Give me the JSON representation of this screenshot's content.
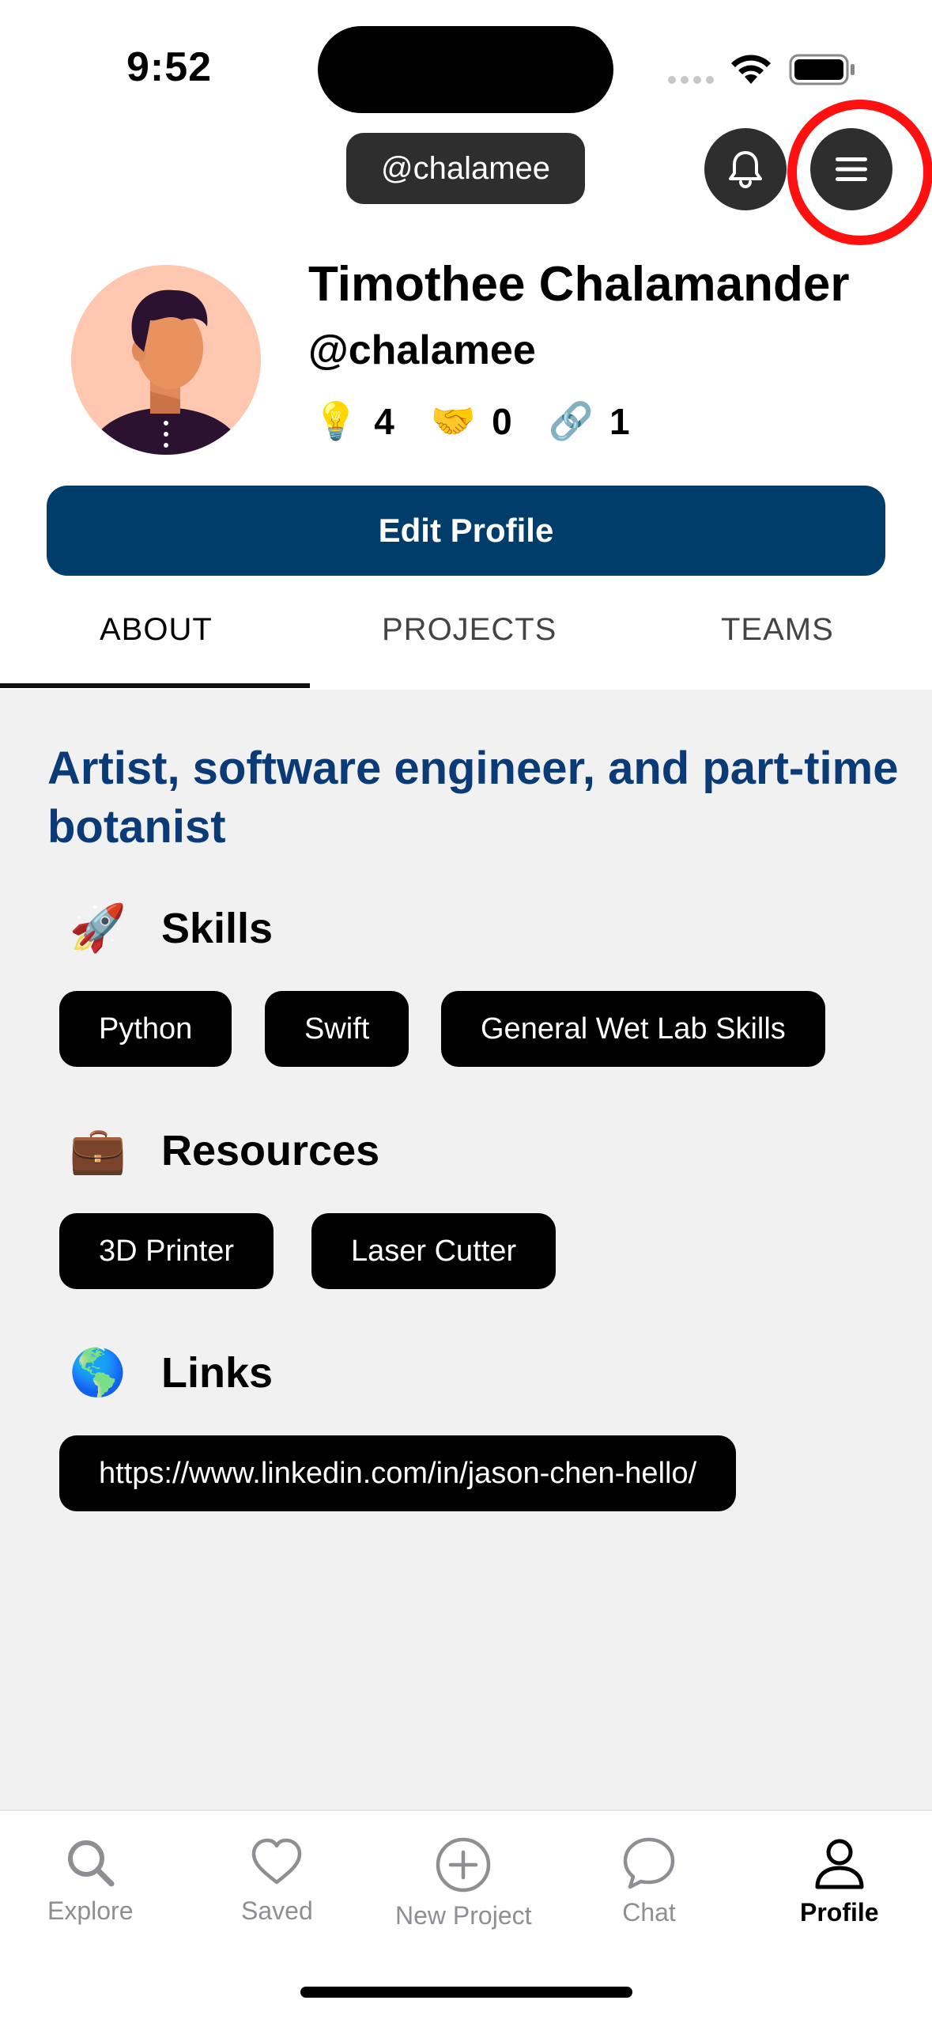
{
  "status_bar": {
    "time": "9:52"
  },
  "header": {
    "handle_pill": "@chalamee"
  },
  "profile": {
    "name": "Timothee Chalamander",
    "handle": "@chalamee",
    "stats": [
      {
        "icon": "lightbulb-icon",
        "emoji": "💡",
        "value": "4"
      },
      {
        "icon": "handshake-icon",
        "emoji": "🤝",
        "value": "0"
      },
      {
        "icon": "link-icon",
        "emoji": "🔗",
        "value": "1"
      }
    ],
    "edit_button": "Edit Profile"
  },
  "tabs": [
    {
      "label": "ABOUT",
      "active": true
    },
    {
      "label": "PROJECTS",
      "active": false
    },
    {
      "label": "TEAMS",
      "active": false
    }
  ],
  "about": {
    "bio": "Artist, software engineer, and part-time botanist",
    "sections": [
      {
        "emoji": "🚀",
        "title": "Skills",
        "chips": [
          "Python",
          "Swift",
          "General Wet Lab Skills"
        ]
      },
      {
        "emoji": "💼",
        "title": "Resources",
        "chips": [
          "3D Printer",
          "Laser Cutter"
        ]
      },
      {
        "emoji": "🌎",
        "title": "Links",
        "chips": [
          "https://www.linkedin.com/in/jason-chen-hello/"
        ]
      }
    ]
  },
  "bottom_nav": [
    {
      "label": "Explore",
      "icon": "search-icon"
    },
    {
      "label": "Saved",
      "icon": "heart-icon"
    },
    {
      "label": "New Project",
      "icon": "plus-circle-icon"
    },
    {
      "label": "Chat",
      "icon": "chat-bubble-icon"
    },
    {
      "label": "Profile",
      "icon": "person-icon",
      "active": true
    }
  ],
  "colors": {
    "primary_button": "#003d6b",
    "bio_text": "#0a3b77",
    "highlight_ring": "#ff1010",
    "content_bg": "#f1f1f1"
  }
}
